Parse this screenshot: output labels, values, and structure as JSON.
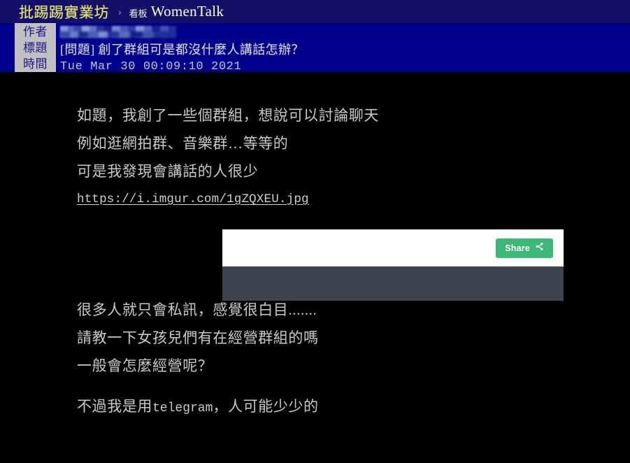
{
  "navbar": {
    "site_name": "批踢踢實業坊",
    "separator": "›",
    "board_label": "看板",
    "board_name": "WomenTalk"
  },
  "article_meta": {
    "labels": {
      "author": "作者",
      "title": "標題",
      "time": "時間"
    },
    "author_value": "",
    "title_value": "[問題] 創了群組可是都沒什麼人講話怎辦？",
    "time_value": "Tue  Mar 30 00:09:10 2021"
  },
  "article_body": {
    "lines_before_link": [
      "如題，我創了一些個群組，想說可以討論聊天",
      "例如逛網拍群、音樂群…等等的",
      "可是我發現會講話的人很少"
    ],
    "link_text": "https://i.imgur.com/1gZQXEU.jpg",
    "lines_after_embed": [
      "很多人就只會私訊，感覺很白目.......",
      "請教一下女孩兒們有在經營群組的嗎",
      "一般會怎麼經營呢？"
    ],
    "final_line_prefix": "不過我是用",
    "final_line_mono": "telegram",
    "final_line_suffix": "，人可能少少的"
  },
  "embed": {
    "share_button_label": "Share",
    "share_icon": "share-icon",
    "top_background_color": "#ffffff",
    "bottom_background_color": "#3d4450",
    "button_color": "#3cb878"
  },
  "colors": {
    "navbar_background": "#151067",
    "meta_header_background": "#00008c",
    "meta_label_background": "#c0c0c0",
    "meta_label_text": "#1a1a8c",
    "page_background": "#000000",
    "body_text": "#c9c9c9",
    "site_name_text": "#e8e86a"
  }
}
